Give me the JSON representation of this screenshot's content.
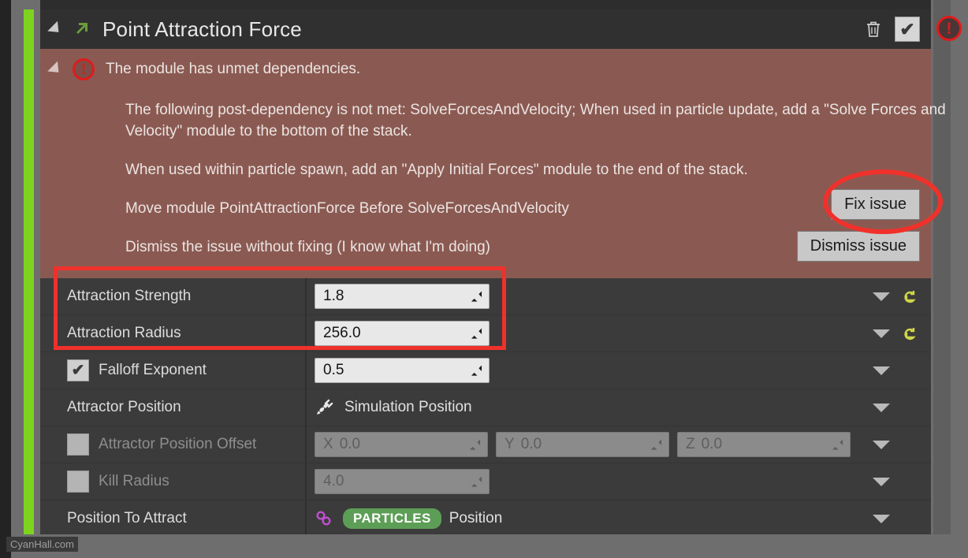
{
  "module": {
    "title": "Point Attraction Force",
    "icon": "force-arrow-icon",
    "collapse_icon": "triangle-collapse-icon",
    "delete_icon": "trash-icon",
    "enabled_checkbox": "checked",
    "check_glyph": "✔"
  },
  "external_warning": {
    "icon": "warning-circle-icon",
    "glyph": "!"
  },
  "issue": {
    "title": "The module has unmet dependencies.",
    "warning_icon": "warning-circle-icon",
    "warning_glyph": "!",
    "collapse_icon": "triangle-collapse-icon",
    "paragraph1": "The following post-dependency is not met: SolveForcesAndVelocity; When used in particle update, add a \"Solve Forces and Velocity\" module to the bottom of the stack.",
    "paragraph2": "When used within particle spawn, add an \"Apply Initial Forces\" module to the end of the stack.",
    "action_link": "Move module PointAttractionForce Before SolveForcesAndVelocity",
    "dismiss_link": "Dismiss the issue without fixing (I know what I'm doing)",
    "fix_button": "Fix issue",
    "dismiss_button": "Dismiss issue"
  },
  "colors": {
    "issue_background": "#8a5a52",
    "annotation_red": "#f0312b",
    "namespace_green": "#5d9e56",
    "accent_green_bar": "#7ed31f",
    "reset_yellow": "#cfd648",
    "link_magenta": "#c04fd0"
  },
  "parameters": [
    {
      "label": "Attraction Strength",
      "value": "1.8",
      "has_checkbox": false,
      "enabled": true,
      "has_caret": true,
      "has_reset": true,
      "kind": "number"
    },
    {
      "label": "Attraction Radius",
      "value": "256.0",
      "has_checkbox": false,
      "enabled": true,
      "has_caret": true,
      "has_reset": true,
      "kind": "number"
    },
    {
      "label": "Falloff Exponent",
      "value": "0.5",
      "has_checkbox": true,
      "checked": true,
      "enabled": true,
      "has_caret": true,
      "has_reset": false,
      "kind": "number"
    },
    {
      "label": "Attractor Position",
      "value": "Simulation Position",
      "has_checkbox": false,
      "enabled": true,
      "has_caret": true,
      "has_reset": false,
      "kind": "linked",
      "icon": "plug-icon"
    },
    {
      "label": "Attractor Position Offset",
      "has_checkbox": true,
      "checked": false,
      "enabled": false,
      "has_caret": true,
      "has_reset": false,
      "kind": "vector3",
      "components": [
        {
          "axis": "X",
          "value": "0.0"
        },
        {
          "axis": "Y",
          "value": "0.0"
        },
        {
          "axis": "Z",
          "value": "0.0"
        }
      ]
    },
    {
      "label": "Kill Radius",
      "value": "4.0",
      "has_checkbox": true,
      "checked": false,
      "enabled": false,
      "has_caret": true,
      "has_reset": false,
      "kind": "number"
    },
    {
      "label": "Position To Attract",
      "has_checkbox": false,
      "enabled": true,
      "has_caret": true,
      "has_reset": false,
      "kind": "namespaced",
      "icon": "link-chain-icon",
      "namespace": "PARTICLES",
      "attribute": "Position"
    }
  ],
  "watermark": "CyanHall.com"
}
